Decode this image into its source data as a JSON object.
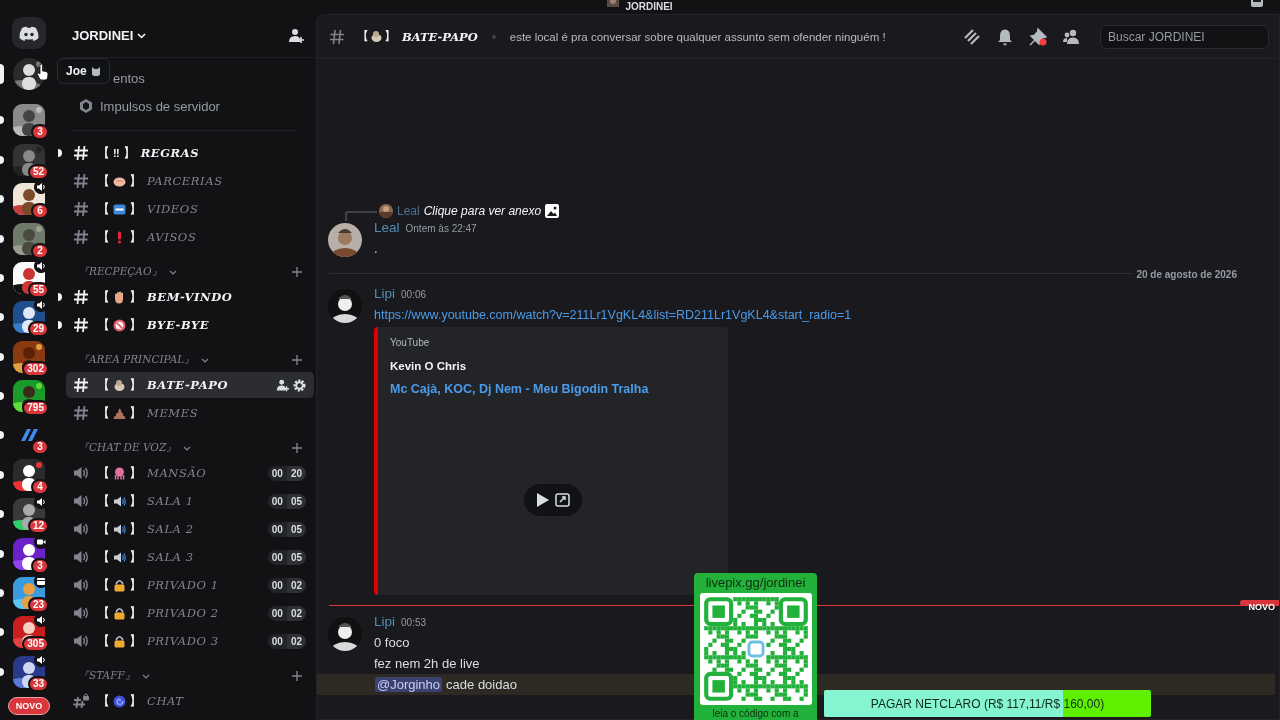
{
  "top_bar": {
    "title": "JORDINEI"
  },
  "servers": {
    "tooltip": "Joe",
    "items": [
      {
        "hovered": true,
        "unread": true
      },
      {
        "badge": "3",
        "unread": true,
        "hovered": false
      },
      {
        "badge": "52",
        "unread": true,
        "hovered": false
      },
      {
        "badge": "6",
        "kind": "voice",
        "unread": true,
        "hovered": false
      },
      {
        "badge": "2",
        "unread": true,
        "hovered": false
      },
      {
        "badge": "55",
        "kind": "voice",
        "unread": true,
        "hovered": false
      },
      {
        "badge": "29",
        "kind": "voice",
        "unread": true,
        "hovered": false
      },
      {
        "badge": "302",
        "unread": true,
        "hovered": false
      },
      {
        "badge": "795",
        "unread": true,
        "hovered": false
      },
      {
        "badge": "3",
        "unread": true,
        "hovered": false
      },
      {
        "badge": "4",
        "unread": true,
        "hovered": false
      },
      {
        "badge": "12",
        "kind": "voice",
        "unread": true,
        "hovered": false
      },
      {
        "badge": "3",
        "kind": "video",
        "unread": true,
        "hovered": false
      },
      {
        "badge": "23",
        "kind": "event",
        "unread": true,
        "hovered": false
      },
      {
        "badge": "305",
        "kind": "voice",
        "unread": true,
        "hovered": false
      },
      {
        "badge": "33",
        "kind": "voice",
        "unread": true,
        "hovered": false
      }
    ],
    "new_pill": "NOVO"
  },
  "sidebar": {
    "server_name": "JORDINEI",
    "links": [
      {
        "kind": "covered",
        "label": "entos"
      },
      {
        "kind": "boost",
        "label": "Impulsos de servidor"
      }
    ],
    "sections": [
      {
        "channels": [
          {
            "kind": "text",
            "open": "【",
            "symbol": "‼",
            "close": "】",
            "name": "REGRAS",
            "unread": true,
            "selected": false
          },
          {
            "kind": "text",
            "open": "【",
            "close": "】",
            "name": "PARCERIAS",
            "unread": false,
            "selected": false
          },
          {
            "kind": "text",
            "open": "【",
            "close": "】",
            "name": "VIDEOS",
            "unread": false,
            "selected": false
          },
          {
            "kind": "text",
            "open": "【",
            "close": "】",
            "name": "AVISOS",
            "unread": false,
            "selected": false
          }
        ]
      },
      {
        "category": "『RECPEÇAO』",
        "channels": [
          {
            "kind": "text",
            "open": "【",
            "close": "】",
            "name": "BEM-VINDO",
            "unread": true,
            "selected": false
          },
          {
            "kind": "text",
            "open": "【",
            "close": "】",
            "name": "BYE-BYE",
            "unread": true,
            "selected": false
          }
        ]
      },
      {
        "category": "『AREA PRINCIPAL』",
        "channels": [
          {
            "kind": "text",
            "open": "【",
            "close": "】",
            "name": "BATE-PAPO",
            "unread": false,
            "selected": true
          },
          {
            "kind": "text",
            "open": "【",
            "close": "】",
            "name": "MEMES",
            "unread": false,
            "selected": false
          }
        ]
      },
      {
        "category": "『CHAT DE VOZ』",
        "channels": [
          {
            "kind": "voice",
            "open": "【",
            "close": "】",
            "name": "MANSÃO",
            "unread": false,
            "selected": false,
            "counts": [
              "00",
              "20"
            ]
          },
          {
            "kind": "voice",
            "open": "【",
            "close": "】",
            "name": "SALA 1",
            "unread": false,
            "selected": false,
            "counts": [
              "00",
              "05"
            ]
          },
          {
            "kind": "voice",
            "open": "【",
            "close": "】",
            "name": "SALA 2",
            "unread": false,
            "selected": false,
            "counts": [
              "00",
              "05"
            ]
          },
          {
            "kind": "voice",
            "open": "【",
            "close": "】",
            "name": "SALA 3",
            "unread": false,
            "selected": false,
            "counts": [
              "00",
              "05"
            ]
          },
          {
            "kind": "voice",
            "open": "【",
            "close": "】",
            "name": "PRIVADO 1",
            "unread": false,
            "selected": false,
            "counts": [
              "00",
              "02"
            ]
          },
          {
            "kind": "voice",
            "open": "【",
            "close": "】",
            "name": "PRIVADO 2",
            "unread": false,
            "selected": false,
            "counts": [
              "00",
              "02"
            ]
          },
          {
            "kind": "voice",
            "open": "【",
            "close": "】",
            "name": "PRIVADO 3",
            "unread": false,
            "selected": false,
            "counts": [
              "00",
              "02"
            ]
          }
        ]
      },
      {
        "category": "『STAFF』",
        "channels": [
          {
            "kind": "locked",
            "open": "【",
            "close": "】",
            "name": "CHAT",
            "unread": false,
            "selected": false
          }
        ]
      }
    ]
  },
  "header": {
    "open": "【",
    "close": "】",
    "name": "BATE-PAPO",
    "topic": "este local é pra conversar sobre qualquer assunto sem ofender ninguém !",
    "pins_unread": true,
    "search": {
      "placeholder": "Buscar JORDINEI"
    }
  },
  "messages": [
    {
      "kind": "message",
      "author": "Leal",
      "time": "Ontem às 22:47",
      "reply": {
        "author": "Leal",
        "text": "Clique para ver anexo"
      },
      "lines": [
        {
          "text": ".",
          "highlighted": false
        }
      ]
    },
    {
      "kind": "date",
      "text": "20 de agosto de 2026"
    },
    {
      "kind": "message",
      "author": "Lipi",
      "time": "00:06",
      "lines": [
        {
          "link": "https://www.youtube.com/watch?v=211Lr1VgKL4&list=RD211Lr1VgKL4&start_radio=1",
          "highlighted": false
        }
      ],
      "embed": {
        "provider": "YouTube",
        "author": "Kevin O Chris",
        "title": "Mc Cajà, KOC, Dj Nem - Meu Bigodin Tralha"
      }
    },
    {
      "kind": "new",
      "label": "NOVO"
    },
    {
      "kind": "message",
      "author": "Lipi",
      "time": "00:53",
      "lines": [
        {
          "text": "0 foco",
          "highlighted": false
        },
        {
          "text": "fez nem 2h de live",
          "highlighted": false
        },
        {
          "mention": "@Jorginho",
          "text": "cade doidao",
          "highlighted": true
        }
      ]
    }
  ],
  "overlay": {
    "url": "livepix.gg/jordinei",
    "caption": "leia o código com a",
    "goal": {
      "label": "PAGAR NETCLARO (R$ 117,11/R$ 160,00)",
      "level": 0.73
    }
  }
}
